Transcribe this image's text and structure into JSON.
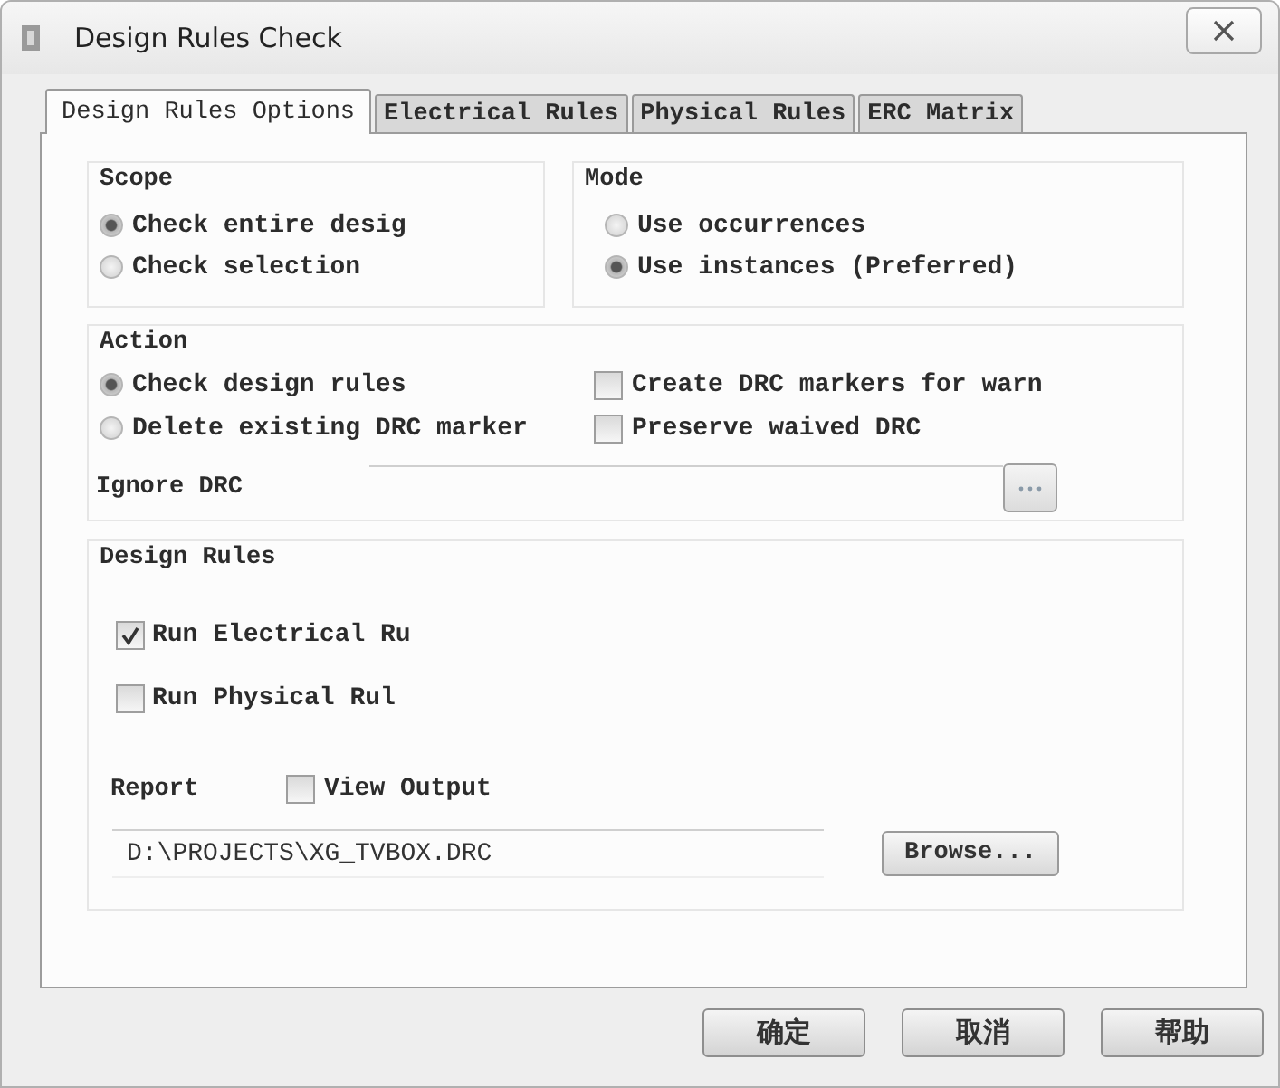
{
  "window": {
    "title": "Design Rules Check"
  },
  "tabs": [
    {
      "label": "Design Rules Options",
      "selected": true
    },
    {
      "label": "Electrical Rules",
      "selected": false
    },
    {
      "label": "Physical Rules",
      "selected": false
    },
    {
      "label": "ERC Matrix",
      "selected": false
    }
  ],
  "scope": {
    "label": "Scope",
    "options": [
      {
        "label": "Check entire desig",
        "selected": true
      },
      {
        "label": "Check selection",
        "selected": false
      }
    ]
  },
  "mode": {
    "label": "Mode",
    "options": [
      {
        "label": "Use occurrences",
        "selected": false
      },
      {
        "label": "Use instances (Preferred)",
        "selected": true
      }
    ]
  },
  "action": {
    "label": "Action",
    "options": [
      {
        "label": "Check design rules",
        "selected": true
      },
      {
        "label": "Delete existing DRC marker",
        "selected": false
      }
    ],
    "checkboxes": [
      {
        "label": "Create DRC markers for warn",
        "checked": false
      },
      {
        "label": "Preserve waived DRC",
        "checked": false
      }
    ],
    "ignore_drc": {
      "label": "Ignore DRC"
    }
  },
  "design_rules": {
    "label": "Design Rules",
    "checkboxes": [
      {
        "label": "Run Electrical Ru",
        "checked": true
      },
      {
        "label": "Run Physical Rul",
        "checked": false
      }
    ],
    "report": {
      "label": "Report",
      "view_output": {
        "label": "View Output",
        "checked": false
      },
      "file": {
        "value": "D:\\PROJECTS\\XG_TVBOX.DRC"
      },
      "browse_button": "Browse..."
    }
  },
  "buttons": [
    "确定",
    "取消",
    "帮助"
  ]
}
